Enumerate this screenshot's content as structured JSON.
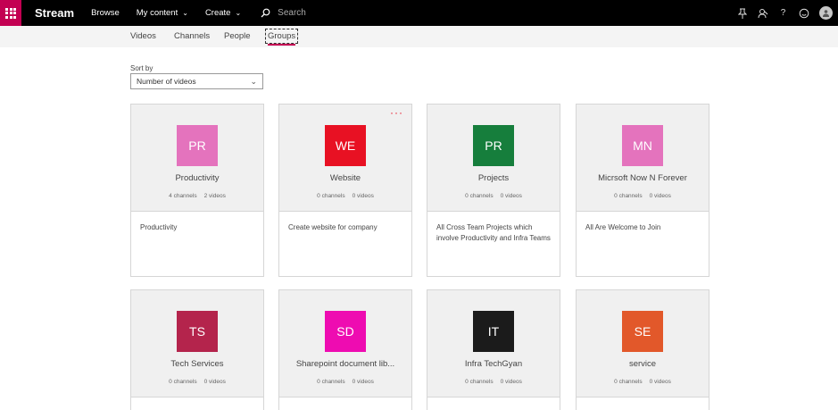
{
  "topbar": {
    "brand": "Stream",
    "browse": "Browse",
    "my_content": "My content",
    "create": "Create",
    "search_placeholder": "Search",
    "icons": [
      "pin-icon",
      "people-icon",
      "help-icon",
      "smiley-icon",
      "avatar-icon"
    ]
  },
  "subnav": {
    "tabs": [
      "Videos",
      "Channels",
      "People",
      "Groups"
    ],
    "active": "Groups"
  },
  "sort": {
    "label": "Sort by",
    "value": "Number of videos"
  },
  "colors": {
    "brand": "#c30052",
    "more_dots": "#e81123"
  },
  "groups": [
    {
      "initials": "PR",
      "name": "Productivity",
      "channels": "4 channels",
      "videos": "2 videos",
      "description": "Productivity",
      "color": "#e473bd"
    },
    {
      "initials": "WE",
      "name": "Website",
      "channels": "0 channels",
      "videos": "0 videos",
      "description": "Create website for company",
      "color": "#e81123",
      "more": "···"
    },
    {
      "initials": "PR",
      "name": "Projects",
      "channels": "0 channels",
      "videos": "0 videos",
      "description": "All Cross Team Projects which involve Productivity and Infra Teams",
      "color": "#167e3c"
    },
    {
      "initials": "MN",
      "name": "Micrsoft Now N Forever",
      "channels": "0 channels",
      "videos": "0 videos",
      "description": "All Are Welcome to Join",
      "color": "#e473bd"
    },
    {
      "initials": "TS",
      "name": "Tech Services",
      "channels": "0 channels",
      "videos": "0 videos",
      "description": "",
      "color": "#b4244c"
    },
    {
      "initials": "SD",
      "name": "Sharepoint document lib...",
      "channels": "0 channels",
      "videos": "0 videos",
      "description": "",
      "color": "#ee0cb1"
    },
    {
      "initials": "IT",
      "name": "Infra TechGyan",
      "channels": "0 channels",
      "videos": "0 videos",
      "description": "",
      "color": "#1b1b1b"
    },
    {
      "initials": "SE",
      "name": "service",
      "channels": "0 channels",
      "videos": "0 videos",
      "description": "",
      "color": "#e2582a"
    }
  ]
}
